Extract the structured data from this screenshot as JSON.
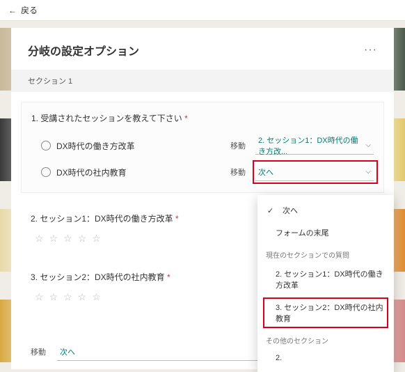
{
  "topbar": {
    "back_label": "戻る"
  },
  "panel": {
    "title": "分岐の設定オプション",
    "section_label": "セクション 1"
  },
  "q1": {
    "title": "1. 受講されたセッションを教えて下さい",
    "go_label": "移動",
    "opt_a": {
      "label": "DX時代の働き方改革",
      "target": "2. セッション1：DX時代の働き方改..."
    },
    "opt_b": {
      "label": "DX時代の社内教育",
      "target": "次へ"
    }
  },
  "q2": {
    "title": "2. セッション1：DX時代の働き方改革"
  },
  "q3": {
    "title": "3. セッション2：DX時代の社内教育"
  },
  "bottom": {
    "go_label": "移動",
    "target": "次へ"
  },
  "menu": {
    "next": "次へ",
    "end": "フォームの末尾",
    "hdr_current": "現在のセクションでの質問",
    "item_s1": "2. セッション1：DX時代の働き方改革",
    "item_s2": "3. セッション2：DX時代の社内教育",
    "hdr_other": "その他のセクション",
    "item_other": "2."
  }
}
